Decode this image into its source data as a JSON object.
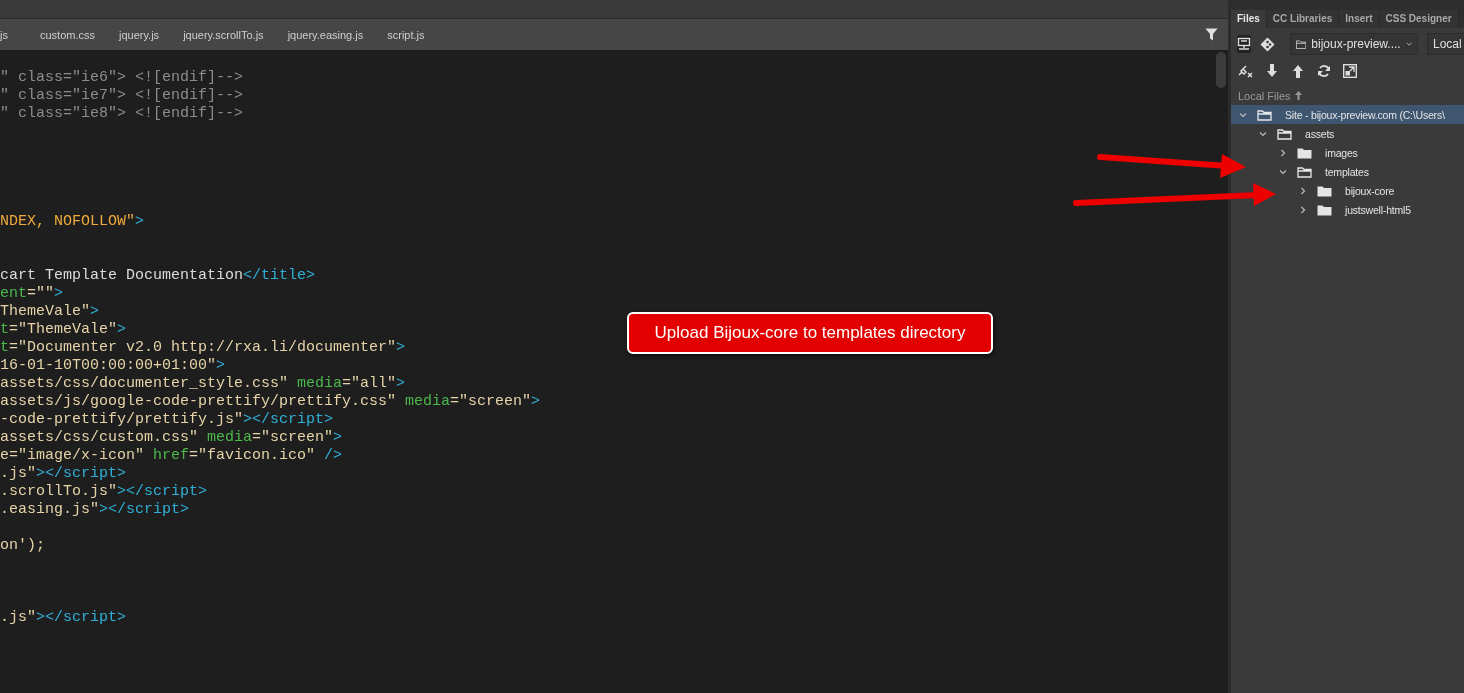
{
  "editor": {
    "tabs": [
      {
        "label": "js"
      },
      {
        "label": "custom.css"
      },
      {
        "label": "jquery.js"
      },
      {
        "label": "jquery.scrollTo.js"
      },
      {
        "label": "jquery.easing.js"
      },
      {
        "label": "script.js"
      }
    ],
    "code_lines": [
      {
        "kind": "code",
        "segments": [
          {
            "kind": "comment",
            "text": "\" class=\"ie6\"> <![endif]-->"
          }
        ]
      },
      {
        "kind": "code",
        "segments": [
          {
            "kind": "comment",
            "text": "\" class=\"ie7\"> <![endif]-->"
          }
        ]
      },
      {
        "kind": "code",
        "segments": [
          {
            "kind": "comment",
            "text": "\" class=\"ie8\"> <![endif]-->"
          }
        ]
      },
      {
        "kind": "blank"
      },
      {
        "kind": "blank"
      },
      {
        "kind": "blank"
      },
      {
        "kind": "blank"
      },
      {
        "kind": "blank"
      },
      {
        "kind": "code",
        "segments": [
          {
            "kind": "keyword",
            "text": "NDEX, NOFOLLOW\""
          },
          {
            "kind": "tag",
            "text": ">"
          }
        ]
      },
      {
        "kind": "blank"
      },
      {
        "kind": "blank"
      },
      {
        "kind": "code",
        "segments": [
          {
            "kind": "text",
            "text": "cart Template Documentation"
          },
          {
            "kind": "tag",
            "text": "</title>"
          }
        ]
      },
      {
        "kind": "code",
        "segments": [
          {
            "kind": "attr",
            "text": "ent"
          },
          {
            "kind": "string",
            "text": "=\"\""
          },
          {
            "kind": "tag",
            "text": ">"
          }
        ]
      },
      {
        "kind": "code",
        "segments": [
          {
            "kind": "string",
            "text": "ThemeVale\""
          },
          {
            "kind": "tag",
            "text": ">"
          }
        ]
      },
      {
        "kind": "code",
        "segments": [
          {
            "kind": "attr",
            "text": "t"
          },
          {
            "kind": "string",
            "text": "=\"ThemeVale\""
          },
          {
            "kind": "tag",
            "text": ">"
          }
        ]
      },
      {
        "kind": "code",
        "segments": [
          {
            "kind": "attr",
            "text": "t"
          },
          {
            "kind": "string",
            "text": "=\"Documenter v2.0 http://rxa.li/documenter\""
          },
          {
            "kind": "tag",
            "text": ">"
          }
        ]
      },
      {
        "kind": "code",
        "segments": [
          {
            "kind": "string",
            "text": "16-01-10T00:00:00+01:00\""
          },
          {
            "kind": "tag",
            "text": ">"
          }
        ]
      },
      {
        "kind": "code",
        "segments": [
          {
            "kind": "string",
            "text": "assets/css/documenter_style.css\" "
          },
          {
            "kind": "attr",
            "text": "media"
          },
          {
            "kind": "string",
            "text": "=\"all\""
          },
          {
            "kind": "tag",
            "text": ">"
          }
        ]
      },
      {
        "kind": "code",
        "segments": [
          {
            "kind": "string",
            "text": "assets/js/google-code-prettify/prettify.css\" "
          },
          {
            "kind": "attr",
            "text": "media"
          },
          {
            "kind": "string",
            "text": "=\"screen\""
          },
          {
            "kind": "tag",
            "text": ">"
          }
        ]
      },
      {
        "kind": "code",
        "segments": [
          {
            "kind": "string",
            "text": "-code-prettify/prettify.js\""
          },
          {
            "kind": "tag",
            "text": "></script>"
          }
        ]
      },
      {
        "kind": "code",
        "segments": [
          {
            "kind": "string",
            "text": "assets/css/custom.css\" "
          },
          {
            "kind": "attr",
            "text": "media"
          },
          {
            "kind": "string",
            "text": "=\"screen\""
          },
          {
            "kind": "tag",
            "text": ">"
          }
        ]
      },
      {
        "kind": "code",
        "segments": [
          {
            "kind": "string",
            "text": "e=\"image/x-icon\" "
          },
          {
            "kind": "attr",
            "text": "href"
          },
          {
            "kind": "string",
            "text": "=\"favicon.ico\" "
          },
          {
            "kind": "tag",
            "text": "/>"
          }
        ]
      },
      {
        "kind": "code",
        "segments": [
          {
            "kind": "string",
            "text": ".js\""
          },
          {
            "kind": "tag",
            "text": "></script>"
          }
        ]
      },
      {
        "kind": "code",
        "segments": [
          {
            "kind": "string",
            "text": ".scrollTo.js\""
          },
          {
            "kind": "tag",
            "text": "></script>"
          }
        ]
      },
      {
        "kind": "code",
        "segments": [
          {
            "kind": "string",
            "text": ".easing.js\""
          },
          {
            "kind": "tag",
            "text": "></script>"
          }
        ]
      },
      {
        "kind": "blank"
      },
      {
        "kind": "code",
        "segments": [
          {
            "kind": "string",
            "text": "on');"
          }
        ]
      },
      {
        "kind": "blank"
      },
      {
        "kind": "blank"
      },
      {
        "kind": "blank"
      },
      {
        "kind": "code",
        "segments": [
          {
            "kind": "string",
            "text": ".js\""
          },
          {
            "kind": "tag",
            "text": "></script>"
          }
        ]
      }
    ]
  },
  "files_panel": {
    "tabs": [
      {
        "label": "Files",
        "selected": true
      },
      {
        "label": "CC Libraries",
        "selected": false
      },
      {
        "label": "Insert",
        "selected": false
      },
      {
        "label": "CSS Designer",
        "selected": false
      }
    ],
    "site_select": "bijoux-preview....",
    "view_select": "Local",
    "section_label": "Local Files",
    "tree": [
      {
        "label": "Site - bijoux-preview.com (C:\\Users\\",
        "selected": true,
        "expanded": true,
        "children": [
          {
            "label": "assets",
            "selected": false,
            "expanded": true,
            "children": [
              {
                "label": "images",
                "selected": false,
                "expanded": false
              },
              {
                "label": "templates",
                "selected": false,
                "expanded": true,
                "children": [
                  {
                    "label": "bijoux-core",
                    "selected": false,
                    "expanded": false
                  },
                  {
                    "label": "justswell-html5",
                    "selected": false,
                    "expanded": false
                  }
                ]
              }
            ]
          }
        ]
      }
    ]
  },
  "callout": {
    "text": "Upload Bijoux-core to templates directory"
  }
}
